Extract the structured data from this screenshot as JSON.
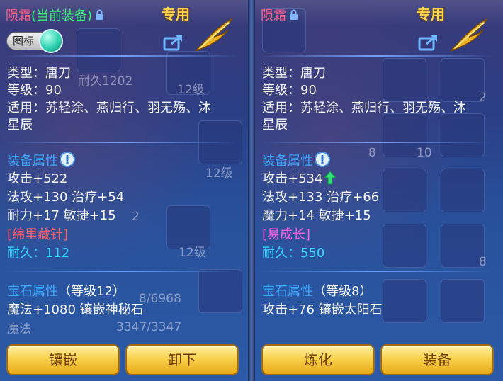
{
  "left": {
    "name": "陨霜",
    "equipped_tag": "(当前装备)",
    "tag": "专用",
    "badge_label": "图标",
    "type_line": "类型：唐刀",
    "level_line": "等级：90",
    "applies_line1": "适用：苏轻涂、燕归行、羽无殇、沐",
    "applies_line2": "星辰",
    "equip_attr_header": "装备属性",
    "attr1": "攻击+522",
    "attr2": "法攻+130 治疗+54",
    "attr3": "耐力+17 敏捷+15",
    "special": "[绵里藏针]",
    "durability": "耐久：112",
    "gem_header": "宝石属性",
    "gem_level": "（等级12）",
    "gem_attr": "魔法+1080 镶嵌神秘石",
    "button_left": "镶嵌",
    "button_right": "卸下"
  },
  "right": {
    "name": "陨霜",
    "tag": "专用",
    "type_line": "类型：唐刀",
    "level_line": "等级：90",
    "applies_line1": "适用：苏轻涂、燕归行、羽无殇、沐",
    "applies_line2": "星辰",
    "equip_attr_header": "装备属性",
    "attr1": "攻击+534",
    "attr2": "法攻+133 治疗+66",
    "attr3": "魔力+14 敏捷+15",
    "special": "[易成长]",
    "durability": "耐久：550",
    "gem_header": "宝石属性",
    "gem_level": "（等级8）",
    "gem_attr": "攻击+76 镶嵌太阳石",
    "button_left": "炼化",
    "button_right": "装备"
  },
  "background": {
    "cell_labels": [
      "耐久1202",
      "12级",
      "12级",
      "2",
      "12级",
      "8/6968",
      "3347/3347",
      "魔法",
      "2",
      "8",
      "10",
      "8"
    ]
  },
  "colors": {
    "name_red": "#ff5c8a",
    "equipped_green": "#3df07a",
    "tag_gold": "#ffd34a",
    "header_blue": "#3fa7ff",
    "special_red": "#ff5c6e",
    "special_pink": "#ff5ee1",
    "durability_cyan": "#35d6ff",
    "button_gold": "#f9d24d"
  },
  "icons": [
    "lock-icon",
    "share-icon",
    "wing-icon",
    "info-icon",
    "up-arrow-icon",
    "gem-orb-icon"
  ]
}
